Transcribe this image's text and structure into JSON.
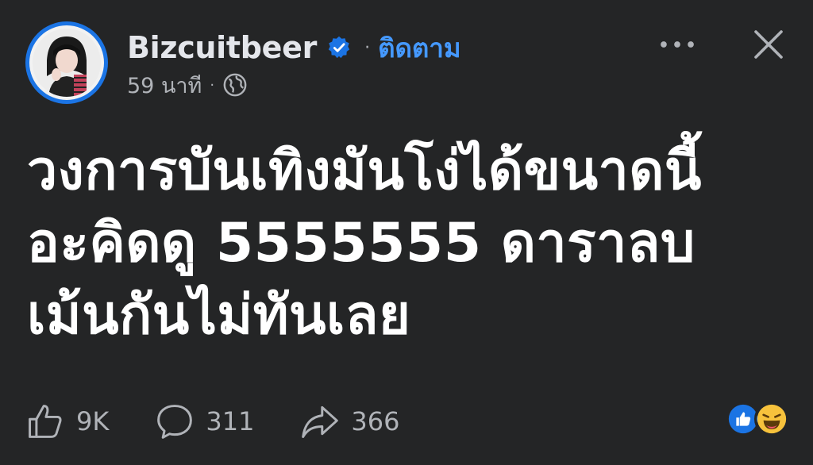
{
  "post": {
    "author": "Bizcuitbeer",
    "separator": "·",
    "follow_label": "ติดตาม",
    "time": "59 นาที",
    "meta_separator": "·",
    "privacy_icon": "globe-icon",
    "text_lines": [
      "วงการบันเทิงมันโง่ได้ขนาดนี้",
      "อะคิดดู 5555555 ดาราลบ",
      "เม้นกันไม่ทันเลย"
    ]
  },
  "footer": {
    "like_count": "9K",
    "comment_count": "311",
    "share_count": "366",
    "reactions": [
      "like-reaction-icon",
      "haha-reaction-icon"
    ]
  },
  "colors": {
    "background": "#242526",
    "accent": "#1b74e4",
    "link": "#4599ff",
    "text": "#ffffff",
    "secondary": "#b0b3b8"
  }
}
